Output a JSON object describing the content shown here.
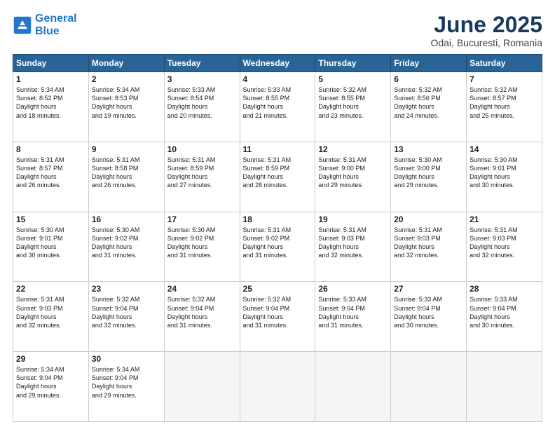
{
  "header": {
    "logo_line1": "General",
    "logo_line2": "Blue",
    "title": "June 2025",
    "subtitle": "Odai, Bucuresti, Romania"
  },
  "calendar": {
    "days_of_week": [
      "Sunday",
      "Monday",
      "Tuesday",
      "Wednesday",
      "Thursday",
      "Friday",
      "Saturday"
    ],
    "weeks": [
      {
        "days": [
          {
            "num": "1",
            "sunrise": "5:34 AM",
            "sunset": "8:52 PM",
            "daylight": "15 hours and 18 minutes."
          },
          {
            "num": "2",
            "sunrise": "5:34 AM",
            "sunset": "8:53 PM",
            "daylight": "15 hours and 19 minutes."
          },
          {
            "num": "3",
            "sunrise": "5:33 AM",
            "sunset": "8:54 PM",
            "daylight": "15 hours and 20 minutes."
          },
          {
            "num": "4",
            "sunrise": "5:33 AM",
            "sunset": "8:55 PM",
            "daylight": "15 hours and 21 minutes."
          },
          {
            "num": "5",
            "sunrise": "5:32 AM",
            "sunset": "8:55 PM",
            "daylight": "15 hours and 23 minutes."
          },
          {
            "num": "6",
            "sunrise": "5:32 AM",
            "sunset": "8:56 PM",
            "daylight": "15 hours and 24 minutes."
          },
          {
            "num": "7",
            "sunrise": "5:32 AM",
            "sunset": "8:57 PM",
            "daylight": "15 hours and 25 minutes."
          }
        ]
      },
      {
        "days": [
          {
            "num": "8",
            "sunrise": "5:31 AM",
            "sunset": "8:57 PM",
            "daylight": "15 hours and 26 minutes."
          },
          {
            "num": "9",
            "sunrise": "5:31 AM",
            "sunset": "8:58 PM",
            "daylight": "15 hours and 26 minutes."
          },
          {
            "num": "10",
            "sunrise": "5:31 AM",
            "sunset": "8:59 PM",
            "daylight": "15 hours and 27 minutes."
          },
          {
            "num": "11",
            "sunrise": "5:31 AM",
            "sunset": "8:59 PM",
            "daylight": "15 hours and 28 minutes."
          },
          {
            "num": "12",
            "sunrise": "5:31 AM",
            "sunset": "9:00 PM",
            "daylight": "15 hours and 29 minutes."
          },
          {
            "num": "13",
            "sunrise": "5:30 AM",
            "sunset": "9:00 PM",
            "daylight": "15 hours and 29 minutes."
          },
          {
            "num": "14",
            "sunrise": "5:30 AM",
            "sunset": "9:01 PM",
            "daylight": "15 hours and 30 minutes."
          }
        ]
      },
      {
        "days": [
          {
            "num": "15",
            "sunrise": "5:30 AM",
            "sunset": "9:01 PM",
            "daylight": "15 hours and 30 minutes."
          },
          {
            "num": "16",
            "sunrise": "5:30 AM",
            "sunset": "9:02 PM",
            "daylight": "15 hours and 31 minutes."
          },
          {
            "num": "17",
            "sunrise": "5:30 AM",
            "sunset": "9:02 PM",
            "daylight": "15 hours and 31 minutes."
          },
          {
            "num": "18",
            "sunrise": "5:31 AM",
            "sunset": "9:02 PM",
            "daylight": "15 hours and 31 minutes."
          },
          {
            "num": "19",
            "sunrise": "5:31 AM",
            "sunset": "9:03 PM",
            "daylight": "15 hours and 32 minutes."
          },
          {
            "num": "20",
            "sunrise": "5:31 AM",
            "sunset": "9:03 PM",
            "daylight": "15 hours and 32 minutes."
          },
          {
            "num": "21",
            "sunrise": "5:31 AM",
            "sunset": "9:03 PM",
            "daylight": "15 hours and 32 minutes."
          }
        ]
      },
      {
        "days": [
          {
            "num": "22",
            "sunrise": "5:31 AM",
            "sunset": "9:03 PM",
            "daylight": "15 hours and 32 minutes."
          },
          {
            "num": "23",
            "sunrise": "5:32 AM",
            "sunset": "9:04 PM",
            "daylight": "15 hours and 32 minutes."
          },
          {
            "num": "24",
            "sunrise": "5:32 AM",
            "sunset": "9:04 PM",
            "daylight": "15 hours and 31 minutes."
          },
          {
            "num": "25",
            "sunrise": "5:32 AM",
            "sunset": "9:04 PM",
            "daylight": "15 hours and 31 minutes."
          },
          {
            "num": "26",
            "sunrise": "5:33 AM",
            "sunset": "9:04 PM",
            "daylight": "15 hours and 31 minutes."
          },
          {
            "num": "27",
            "sunrise": "5:33 AM",
            "sunset": "9:04 PM",
            "daylight": "15 hours and 30 minutes."
          },
          {
            "num": "28",
            "sunrise": "5:33 AM",
            "sunset": "9:04 PM",
            "daylight": "15 hours and 30 minutes."
          }
        ]
      },
      {
        "days": [
          {
            "num": "29",
            "sunrise": "5:34 AM",
            "sunset": "9:04 PM",
            "daylight": "15 hours and 29 minutes."
          },
          {
            "num": "30",
            "sunrise": "5:34 AM",
            "sunset": "9:04 PM",
            "daylight": "15 hours and 29 minutes."
          },
          {
            "num": "",
            "sunrise": "",
            "sunset": "",
            "daylight": ""
          },
          {
            "num": "",
            "sunrise": "",
            "sunset": "",
            "daylight": ""
          },
          {
            "num": "",
            "sunrise": "",
            "sunset": "",
            "daylight": ""
          },
          {
            "num": "",
            "sunrise": "",
            "sunset": "",
            "daylight": ""
          },
          {
            "num": "",
            "sunrise": "",
            "sunset": "",
            "daylight": ""
          }
        ]
      }
    ]
  }
}
